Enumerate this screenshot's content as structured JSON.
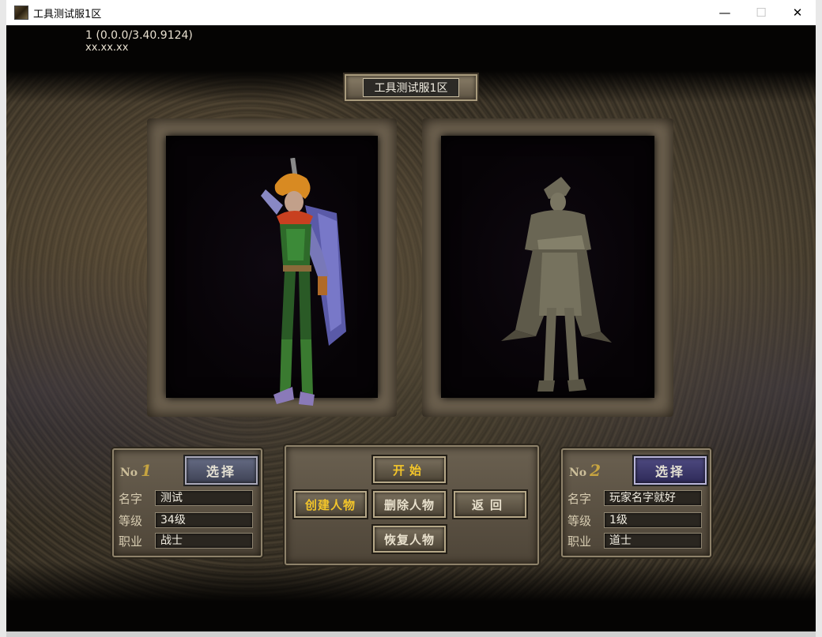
{
  "window": {
    "title": "工具测试服1区",
    "minimize": "—",
    "maximize": "☐",
    "close": "✕"
  },
  "version": {
    "line1": "1 (0.0.0/3.40.9124)",
    "line2": "xx.xx.xx"
  },
  "server_name": "工具测试服1区",
  "slots": [
    {
      "no_label": "No",
      "number": "1",
      "select": "选择",
      "name_label": "名字",
      "name": "测试",
      "level_label": "等级",
      "level": "34级",
      "job_label": "职业",
      "job": "战士"
    },
    {
      "no_label": "No",
      "number": "2",
      "select": "选择",
      "name_label": "名字",
      "name": "玩家名字就好",
      "level_label": "等级",
      "level": "1级",
      "job_label": "职业",
      "job": "道士"
    }
  ],
  "actions": {
    "start": "开始",
    "create": "创建人物",
    "delete": "删除人物",
    "back": "返回",
    "restore": "恢复人物"
  },
  "colors": {
    "gold_text": "#f3c52a",
    "stone": "#6e6250",
    "pit": "#060306"
  }
}
